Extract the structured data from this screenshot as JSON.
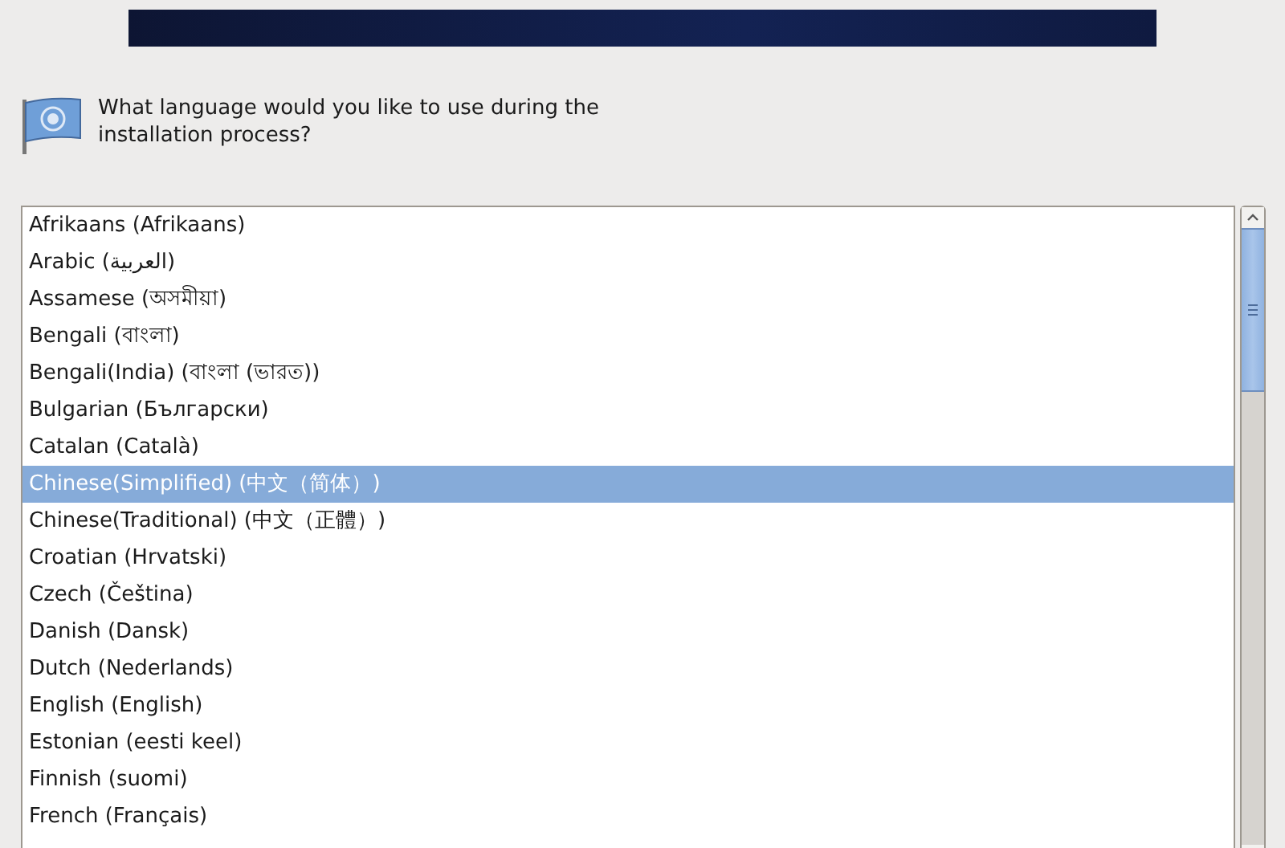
{
  "prompt": "What language would you like to use during the installation process?",
  "languages": [
    {
      "label": "Afrikaans (Afrikaans)",
      "selected": false
    },
    {
      "label": "Arabic (العربية)",
      "selected": false
    },
    {
      "label": "Assamese (অসমীয়া)",
      "selected": false
    },
    {
      "label": "Bengali (বাংলা)",
      "selected": false
    },
    {
      "label": "Bengali(India) (বাংলা (ভারত))",
      "selected": false
    },
    {
      "label": "Bulgarian (Български)",
      "selected": false
    },
    {
      "label": "Catalan (Català)",
      "selected": false
    },
    {
      "label": "Chinese(Simplified) (中文（简体）)",
      "selected": true
    },
    {
      "label": "Chinese(Traditional) (中文（正體）)",
      "selected": false
    },
    {
      "label": "Croatian (Hrvatski)",
      "selected": false
    },
    {
      "label": "Czech (Čeština)",
      "selected": false
    },
    {
      "label": "Danish (Dansk)",
      "selected": false
    },
    {
      "label": "Dutch (Nederlands)",
      "selected": false
    },
    {
      "label": "English (English)",
      "selected": false
    },
    {
      "label": "Estonian (eesti keel)",
      "selected": false
    },
    {
      "label": "Finnish (suomi)",
      "selected": false
    },
    {
      "label": "French (Français)",
      "selected": false
    }
  ]
}
